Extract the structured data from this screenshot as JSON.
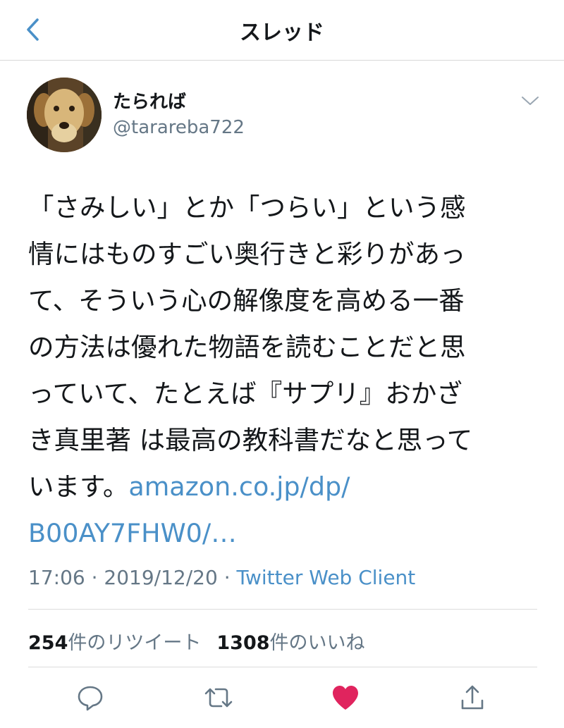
{
  "header": {
    "title": "スレッド",
    "back_icon": "chevron-left-icon"
  },
  "tweet": {
    "author": {
      "display_name": "たられば",
      "handle": "@tarareba722"
    },
    "text_line1": "「さみしい」とか「つらい」という感",
    "text_line2": "情にはものすごい奥行きと彩りがあっ",
    "text_line3": "て、そういう心の解像度を高める一番",
    "text_line4": "の方法は優れた物語を読むことだと思",
    "text_line5": "っていて、たとえば『サプリ』おかざ",
    "text_line6": "き真里著 は最高の教科書だなと思って",
    "text_line7_prefix": "います。",
    "link_part1": "amazon.co.jp/dp/",
    "link_part2": "B00AY7FHW0/…",
    "time": "17:06",
    "date": "2019/12/20",
    "separator": "·",
    "client": "Twitter Web Client"
  },
  "stats": {
    "retweet_count": "254",
    "retweet_label": "件のリツイート",
    "like_count": "1308",
    "like_label": "件のいいね"
  },
  "actions": {
    "reply_icon": "reply-icon",
    "retweet_icon": "retweet-icon",
    "like_icon": "heart-icon",
    "share_icon": "share-icon"
  },
  "colors": {
    "accent": "#4a90c8",
    "like": "#e0245e",
    "secondary_text": "#657786"
  }
}
